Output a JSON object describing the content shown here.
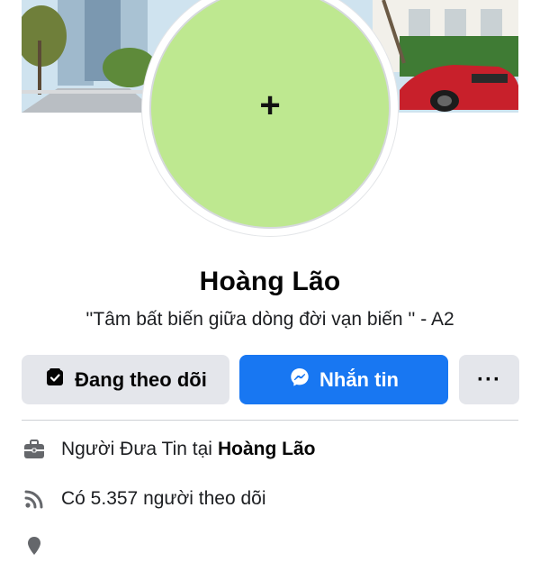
{
  "profile": {
    "name": "Hoàng Lão",
    "bio": "''Tâm bất biến giữa dòng đời vạn biến '' - A2",
    "avatar_placeholder": "+",
    "avatar_color": "#bee890"
  },
  "actions": {
    "follow_label": "Đang theo dõi",
    "message_label": "Nhắn tin",
    "more_label": "···",
    "message_color": "#1877f2",
    "secondary_color": "#e4e6eb"
  },
  "info": {
    "work_prefix": "Người Đưa Tin tại",
    "work_place": "Hoàng Lão",
    "followers_text": "Có 5.357 người theo dõi"
  },
  "icons": {
    "follow": "following-badge-icon",
    "message": "messenger-icon",
    "work": "briefcase-icon",
    "followers": "rss-feed-icon",
    "partial": "location-icon"
  }
}
